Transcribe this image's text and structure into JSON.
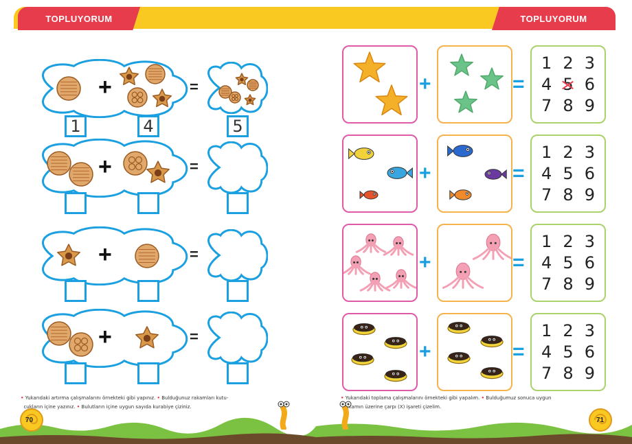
{
  "left_page": {
    "title": "TOPLUYORUM",
    "page_number": "70",
    "rows": [
      {
        "a_items": [
          "round-cookie"
        ],
        "b_items": [
          "star-cookie",
          "round-cookie",
          "flower-cookie",
          "star-cookie"
        ],
        "answer_a": "1",
        "answer_b": "4",
        "answer_sum": "5"
      },
      {
        "a_items": [
          "round-cookie",
          "round-cookie"
        ],
        "b_items": [
          "flower-cookie",
          "star-cookie"
        ],
        "answer_a": "",
        "answer_b": "",
        "answer_sum": ""
      },
      {
        "a_items": [
          "star-cookie"
        ],
        "b_items": [
          "round-cookie"
        ],
        "answer_a": "",
        "answer_b": "",
        "answer_sum": ""
      },
      {
        "a_items": [
          "round-cookie",
          "flower-cookie"
        ],
        "b_items": [
          "star-cookie"
        ],
        "answer_a": "",
        "answer_b": "",
        "answer_sum": ""
      }
    ],
    "plus_sign": "+",
    "equals_sign": "=",
    "instruction_1": "Yukarıdaki artırma çalışmalarını örnekteki gibi yapınız.",
    "instruction_2": "Bulduğunuz rakamları kutu-",
    "instruction_3": "cukların içine yazınız.",
    "instruction_4": "Bulutların içine uygun sayıda kurabiye çiziniz."
  },
  "right_page": {
    "title": "TOPLUYORUM",
    "page_number": "71",
    "plus_sign": "+",
    "equals_sign": "=",
    "rows": [
      {
        "theme": "starfish",
        "a_count": 2,
        "b_count": 3,
        "numbers": [
          "1",
          "2",
          "3",
          "4",
          "5",
          "6",
          "7",
          "8",
          "9"
        ],
        "marked": "5"
      },
      {
        "theme": "fish",
        "a_count": 3,
        "b_count": 3,
        "numbers": [
          "1",
          "2",
          "3",
          "4",
          "5",
          "6",
          "7",
          "8",
          "9"
        ],
        "marked": ""
      },
      {
        "theme": "octopus",
        "a_count": 5,
        "b_count": 2,
        "numbers": [
          "1",
          "2",
          "3",
          "4",
          "5",
          "6",
          "7",
          "8",
          "9"
        ],
        "marked": ""
      },
      {
        "theme": "clam",
        "a_count": 4,
        "b_count": 4,
        "numbers": [
          "1",
          "2",
          "3",
          "4",
          "5",
          "6",
          "7",
          "8",
          "9"
        ],
        "marked": ""
      }
    ],
    "instruction_1": "Yukarıdaki toplama çalışmalarını örnekteki gibi yapalım.",
    "instruction_2": "Bulduğumuz sonuca uygun",
    "instruction_3": "rakamın üzerine çarpı (X) işareti çizelim."
  },
  "colors": {
    "accent_red": "#e73c4c",
    "band_yellow": "#f9c921",
    "cloud_blue": "#1aa0e0",
    "card_pink": "#e05aa8",
    "card_orange": "#f5b24a",
    "card_green": "#a9d26a"
  }
}
